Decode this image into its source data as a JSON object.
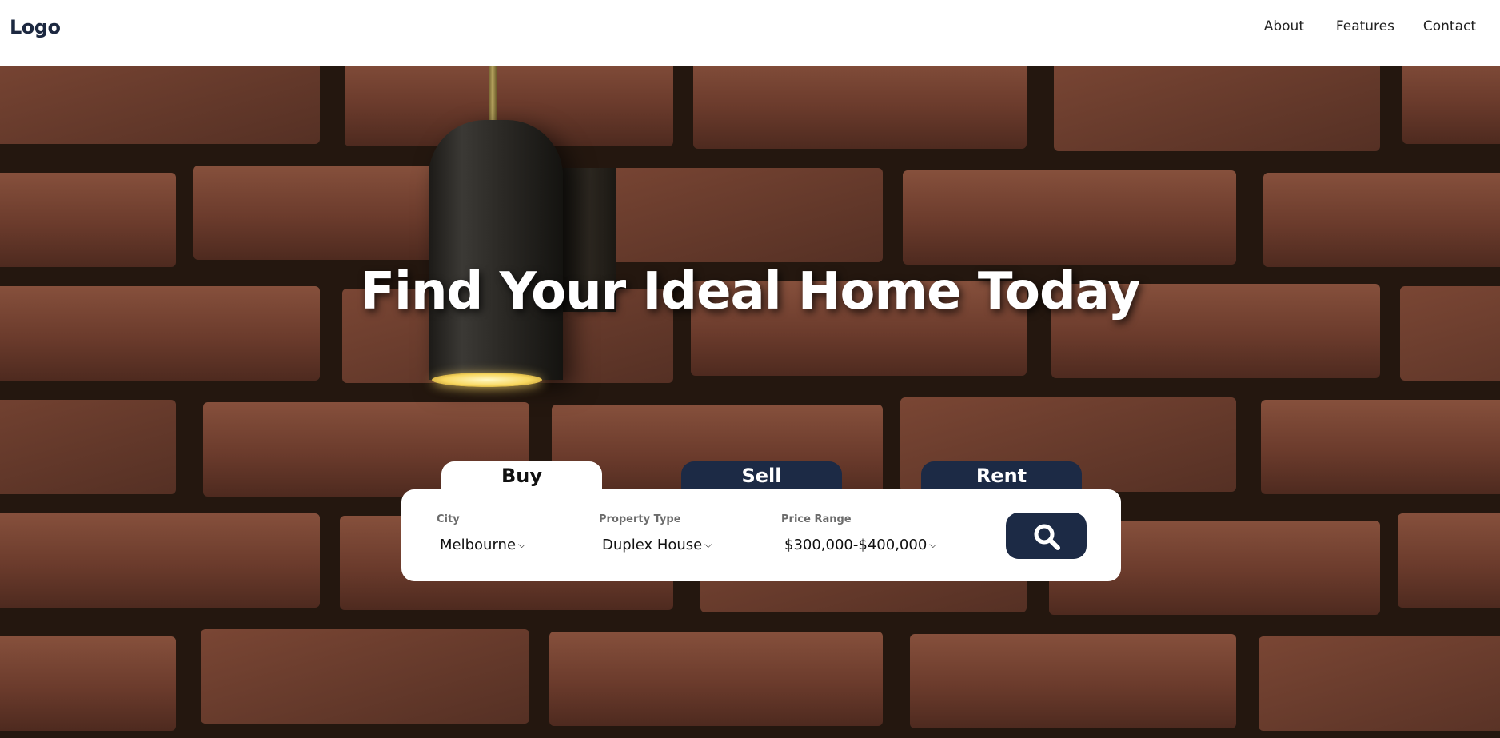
{
  "header": {
    "logo": "Logo",
    "nav": [
      {
        "label": "About"
      },
      {
        "label": "Features"
      },
      {
        "label": "Contact"
      }
    ]
  },
  "hero": {
    "title": "Find Your Ideal Home Today",
    "background": "brick wall with pendant wall lamp"
  },
  "search": {
    "tabs": [
      {
        "label": "Buy",
        "active": true
      },
      {
        "label": "Sell",
        "active": false
      },
      {
        "label": "Rent",
        "active": false
      }
    ],
    "fields": {
      "city": {
        "label": "City",
        "value": "Melbourne"
      },
      "property_type": {
        "label": "Property Type",
        "value": "Duplex House"
      },
      "price_range": {
        "label": "Price Range",
        "value": "$300,000-$400,000"
      }
    },
    "button_icon": "search-icon"
  },
  "colors": {
    "navy": "#1c2a45",
    "white": "#ffffff",
    "brick": "#6e3c2e",
    "mortar": "#2a1c17"
  }
}
